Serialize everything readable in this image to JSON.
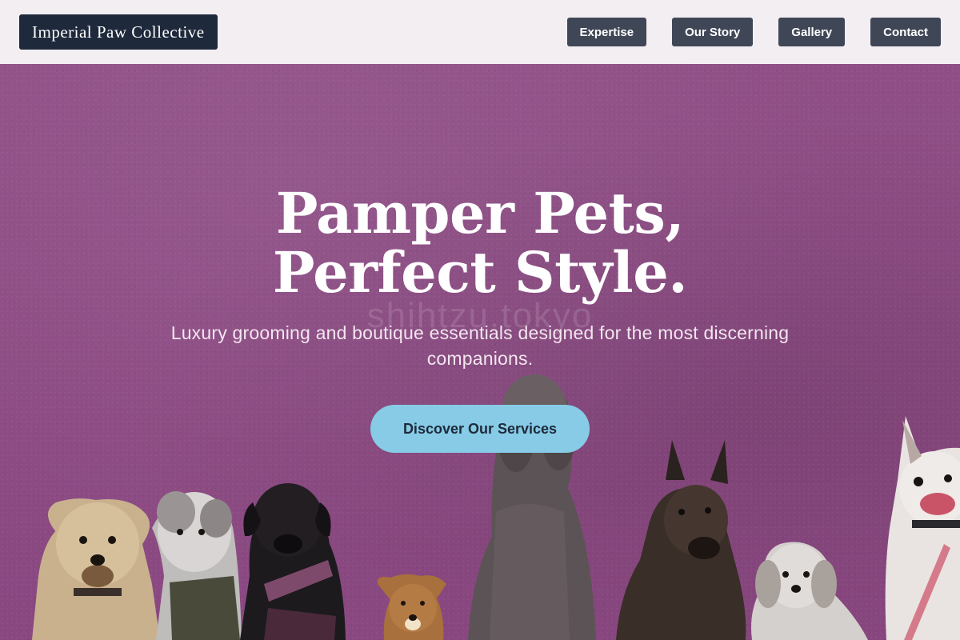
{
  "header": {
    "brand": "Imperial Paw Collective",
    "nav": [
      {
        "label": "Expertise"
      },
      {
        "label": "Our Story"
      },
      {
        "label": "Gallery"
      },
      {
        "label": "Contact"
      }
    ]
  },
  "hero": {
    "title": "Pamper Pets, Perfect Style.",
    "subtitle": "Luxury grooming and boutique essentials designed for the most discerning companions.",
    "cta_label": "Discover Our Services",
    "watermark": "shihtzu.tokyo"
  },
  "colors": {
    "header_bg": "#f3eef2",
    "brand_bg": "#1e293b",
    "nav_bg": "#3f4757",
    "hero_bg": "#8d4c84",
    "cta_bg": "#87cbe6"
  }
}
